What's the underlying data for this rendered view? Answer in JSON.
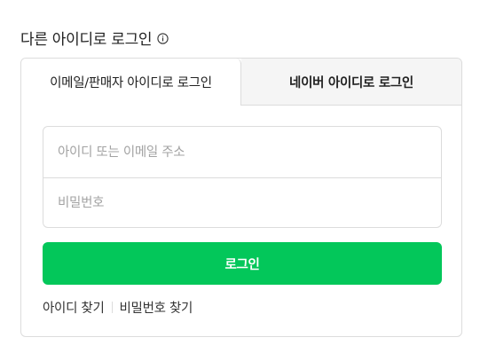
{
  "heading": {
    "title": "다른 아이디로 로그인",
    "info_icon": "info-circle-icon"
  },
  "tabs": [
    {
      "label": "이메일/판매자 아이디로 로그인",
      "active": true
    },
    {
      "label": "네이버 아이디로 로그인",
      "active": false
    }
  ],
  "form": {
    "id_placeholder": "아이디 또는 이메일 주소",
    "id_value": "",
    "password_placeholder": "비밀번호",
    "password_value": ""
  },
  "login_button": {
    "label": "로그인",
    "color": "#03c75a"
  },
  "links": {
    "find_id": "아이디 찾기",
    "find_password": "비밀번호 찾기"
  }
}
